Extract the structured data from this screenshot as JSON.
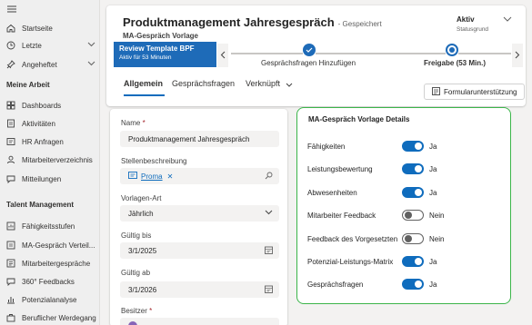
{
  "sidebar": {
    "top_items": [
      {
        "label": "Startseite",
        "icon": "home-icon"
      },
      {
        "label": "Letzte",
        "icon": "clock-icon",
        "has_chevron": true
      },
      {
        "label": "Angeheftet",
        "icon": "pin-icon",
        "has_chevron": true
      }
    ],
    "section1": "Meine Arbeit",
    "work_items": [
      {
        "label": "Dashboards",
        "icon": "dashboard-icon"
      },
      {
        "label": "Aktivitäten",
        "icon": "activity-icon"
      },
      {
        "label": "HR Anfragen",
        "icon": "request-icon"
      },
      {
        "label": "Mitarbeiterverzeichnis",
        "icon": "people-icon"
      },
      {
        "label": "Mitteilungen",
        "icon": "message-icon"
      }
    ],
    "section2": "Talent Management",
    "talent_items": [
      {
        "label": "Fähigkeitsstufen",
        "icon": "skill-icon"
      },
      {
        "label": "MA-Gespräch Verteil...",
        "icon": "distribution-icon"
      },
      {
        "label": "Mitarbeitergespräche",
        "icon": "conversation-icon"
      },
      {
        "label": "360° Feedbacks",
        "icon": "feedback-icon"
      },
      {
        "label": "Potenzialanalyse",
        "icon": "analysis-icon"
      },
      {
        "label": "Beruflicher Werdegang",
        "icon": "career-icon"
      }
    ]
  },
  "header": {
    "title": "Produktmanagement Jahresgespräch",
    "saved": "- Gespeichert",
    "subtitle": "MA-Gespräch Vorlage",
    "status_value": "Aktiv",
    "status_label": "Statusgrund"
  },
  "bpf": {
    "stage_name": "Review Template BPF",
    "stage_time": "Aktiv für 53 Minuten",
    "step1": "Gesprächsfragen Hinzufügen",
    "step2": "Freigabe  (53 Min.)"
  },
  "tabs": [
    "Allgemein",
    "Gesprächsfragen",
    "Verknüpft"
  ],
  "form_util_label": "Formularunterstützung",
  "form": {
    "name_label": "Name",
    "name_value": "Produktmanagement Jahresgespräch",
    "stellen_label": "Stellenbeschreibung",
    "stellen_value": "Proma",
    "art_label": "Vorlagen-Art",
    "art_value": "Jährlich",
    "bis_label": "Gültig bis",
    "bis_value": "3/1/2025",
    "ab_label": "Gültig ab",
    "ab_value": "3/1/2026",
    "besitzer_label": "Besitzer"
  },
  "details": {
    "title": "MA-Gespräch Vorlage Details",
    "rows": [
      {
        "label": "Fähigkeiten",
        "on": true,
        "value": "Ja"
      },
      {
        "label": "Leistungsbewertung",
        "on": true,
        "value": "Ja"
      },
      {
        "label": "Abwesenheiten",
        "on": true,
        "value": "Ja"
      },
      {
        "label": "Mitarbeiter Feedback",
        "on": false,
        "value": "Nein"
      },
      {
        "label": "Feedback des Vorgesetzten",
        "on": false,
        "value": "Nein"
      },
      {
        "label": "Potenzial-Leistungs-Matrix",
        "on": true,
        "value": "Ja"
      },
      {
        "label": "Gesprächsfragen",
        "on": true,
        "value": "Ja"
      }
    ]
  },
  "colors": {
    "accent": "#0f6cbd",
    "bpf": "#1e6bb8",
    "highlight": "#3bb54a"
  }
}
